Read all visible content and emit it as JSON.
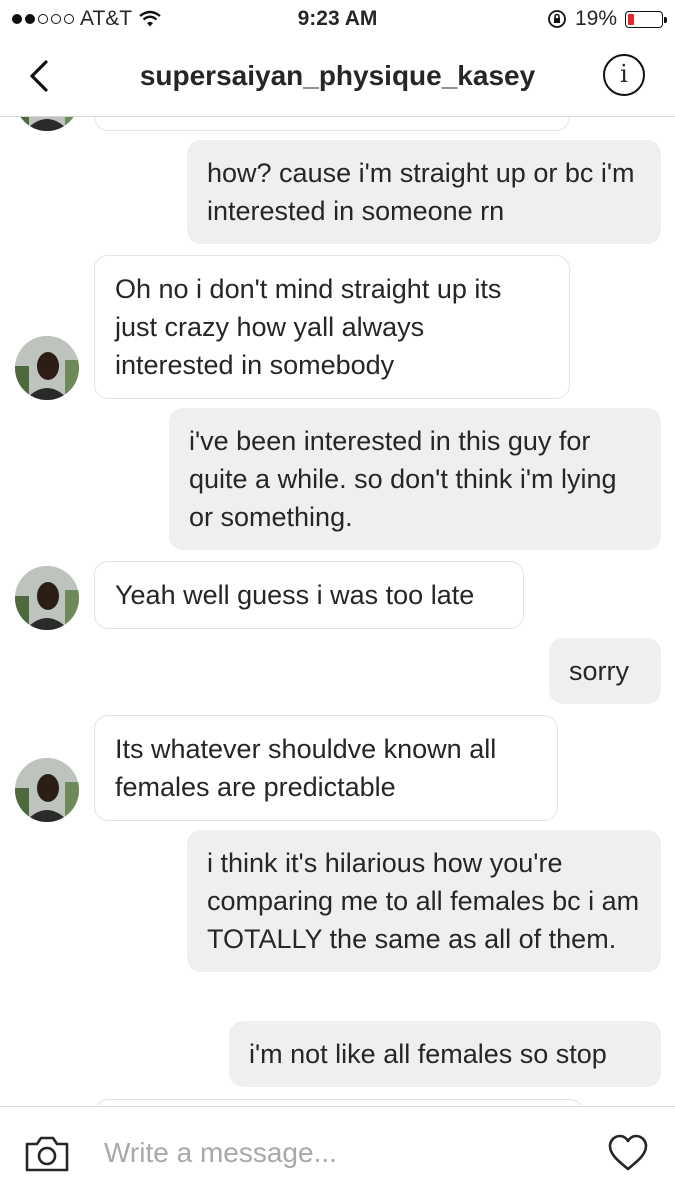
{
  "status_bar": {
    "carrier": "AT&T",
    "time": "9:23 AM",
    "battery": "19%",
    "battery_level": 0.19
  },
  "header": {
    "title": "supersaiyan_physique_kasey"
  },
  "messages": [
    {
      "from": "me",
      "text": "how? cause i'm straight up or bc i'm interested in someone rn"
    },
    {
      "from": "them",
      "text": "Oh no i don't mind straight up its just crazy how yall always interested in somebody"
    },
    {
      "from": "me",
      "text": "i've been interested in this guy for quite a while. so don't think i'm lying or something."
    },
    {
      "from": "them",
      "text": "Yeah well guess i was too late"
    },
    {
      "from": "me",
      "text": "sorry"
    },
    {
      "from": "them",
      "text": "Its whatever shouldve known all females are predictable"
    },
    {
      "from": "me",
      "text": "i think it's hilarious how you're comparing me to all females bc i am TOTALLY the same as all of them."
    },
    {
      "from": "me",
      "text": "i'm not like all females so stop"
    }
  ],
  "composer": {
    "placeholder": "Write a message..."
  }
}
